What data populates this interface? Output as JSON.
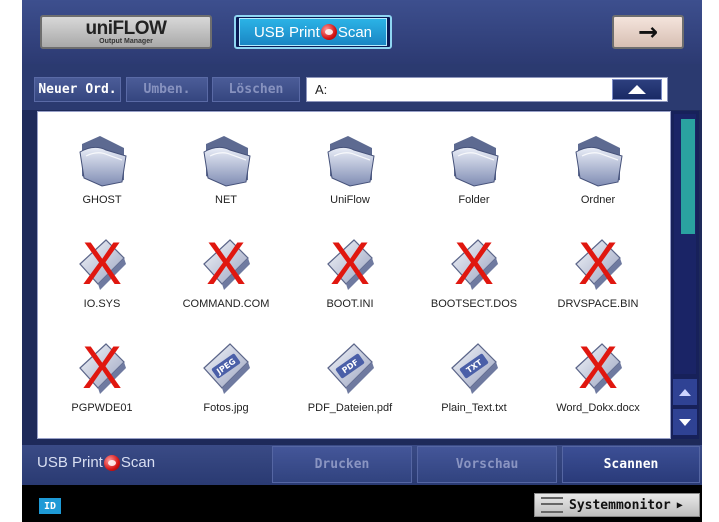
{
  "header": {
    "uniflow_logo": "uniFLOW",
    "uniflow_tagline": "Output Manager",
    "usb_print": "USB Print",
    "usb_scan": "Scan",
    "next_arrow": "→"
  },
  "toolbar": {
    "new_folder": "Neuer Ord.",
    "rename": "Umben.",
    "delete": "Löschen",
    "path": "A:"
  },
  "files": [
    {
      "name": "GHOST",
      "type": "folder",
      "unsupported": false
    },
    {
      "name": "NET",
      "type": "folder",
      "unsupported": false
    },
    {
      "name": "UniFlow",
      "type": "folder",
      "unsupported": false
    },
    {
      "name": "Folder",
      "type": "folder",
      "unsupported": false
    },
    {
      "name": "Ordner",
      "type": "folder",
      "unsupported": false
    },
    {
      "name": "IO.SYS",
      "type": "file",
      "badge": "",
      "unsupported": true
    },
    {
      "name": "COMMAND.COM",
      "type": "file",
      "badge": "",
      "unsupported": true
    },
    {
      "name": "BOOT.INI",
      "type": "file",
      "badge": "",
      "unsupported": true
    },
    {
      "name": "BOOTSECT.DOS",
      "type": "file",
      "badge": "",
      "unsupported": true
    },
    {
      "name": "DRVSPACE.BIN",
      "type": "file",
      "badge": "",
      "unsupported": true
    },
    {
      "name": "PGPWDE01",
      "type": "file",
      "badge": "",
      "unsupported": true
    },
    {
      "name": "Fotos.jpg",
      "type": "file",
      "badge": "JPEG",
      "unsupported": false
    },
    {
      "name": "PDF_Dateien.pdf",
      "type": "file",
      "badge": "PDF",
      "unsupported": false
    },
    {
      "name": "Plain_Text.txt",
      "type": "file",
      "badge": "TXT",
      "unsupported": false
    },
    {
      "name": "Word_Dokx.docx",
      "type": "file",
      "badge": "",
      "unsupported": true
    }
  ],
  "unsupported_mark": "X",
  "bottom": {
    "usb_print": "USB Print",
    "usb_scan": "Scan",
    "print": "Drucken",
    "preview": "Vorschau",
    "scan": "Scannen"
  },
  "status": {
    "id_badge": "ID",
    "system_monitor": "Systemmonitor",
    "caret": "▶"
  },
  "colors": {
    "screen_bg": "#1e2a5a",
    "accent_cyan": "#2bb3e6",
    "scroll_thumb": "#2aa2a0",
    "x_mark": "#e0170f"
  }
}
